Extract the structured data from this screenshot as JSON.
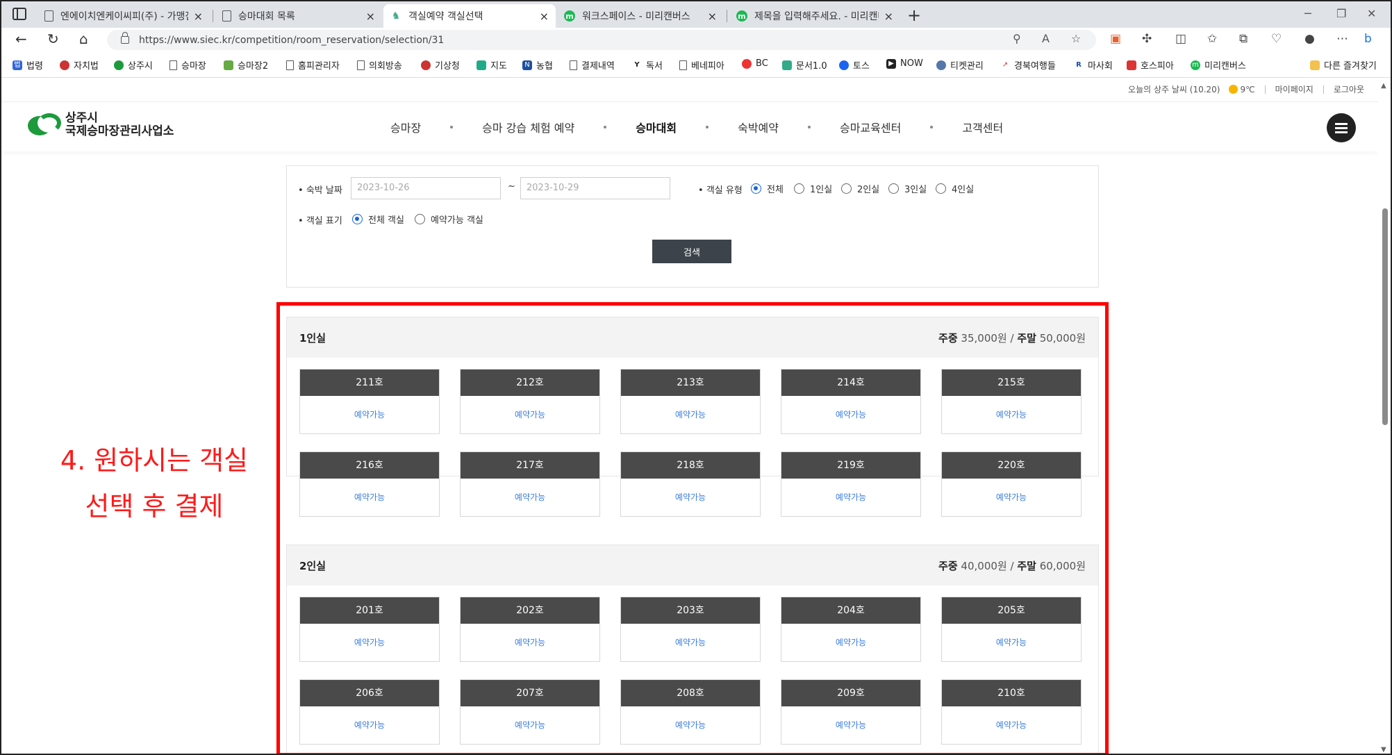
{
  "browser": {
    "tabs": [
      {
        "title": "엔에이치엔케이씨피(주) - 가맹점",
        "icon": "doc"
      },
      {
        "title": "승마대회 목록",
        "icon": "doc"
      },
      {
        "title": "객실예약 객실선택",
        "icon": "horse"
      },
      {
        "title": "워크스페이스 - 미리캔버스",
        "icon": "green"
      },
      {
        "title": "제목을 입력해주세요. - 미리캔버",
        "icon": "green"
      }
    ],
    "url": "https://www.siec.kr/competition/room_reservation/selection/31",
    "bookmarks": [
      "법령",
      "자치법",
      "상주시",
      "승마장",
      "승마장2",
      "홈피관리자",
      "의회방송",
      "기상청",
      "지도",
      "농협",
      "결제내역",
      "독서",
      "베네피아",
      "BC",
      "문서1.0",
      "토스",
      "NOW",
      "티켓관리",
      "경북여행들",
      "마사회",
      "호스피아",
      "미리캔버스"
    ],
    "other_bookmarks": "다른 즐겨찾기"
  },
  "site": {
    "top_info": {
      "weather_label": "오늘의 상주 날씨 (10.20)",
      "temp": "9℃",
      "mypage": "마이페이지",
      "logout": "로그아웃"
    },
    "logo": {
      "line1": "상주시",
      "line2": "국제승마장관리사업소"
    },
    "nav": [
      "승마장",
      "승마 강습 체험 예약",
      "승마대회",
      "숙박예약",
      "승마교육센터",
      "고객센터"
    ],
    "nav_active": "승마대회"
  },
  "search": {
    "date_label": "숙박 날짜",
    "date_from": "2023-10-26",
    "date_to": "2023-10-29",
    "tilde": "~",
    "type_label": "객실 유형",
    "type_options": [
      "전체",
      "1인실",
      "2인실",
      "3인실",
      "4인실"
    ],
    "type_selected": 0,
    "display_label": "객실 표기",
    "display_options": [
      "전체 객실",
      "예약가능 객실"
    ],
    "display_selected": 0,
    "button": "검색"
  },
  "groups": [
    {
      "title": "1인실",
      "weekday_label": "주중",
      "weekday_price": "35,000원",
      "weekend_label": "주말",
      "weekend_price": "50,000원",
      "rooms": [
        {
          "name": "211호",
          "status": "예약가능"
        },
        {
          "name": "212호",
          "status": "예약가능"
        },
        {
          "name": "213호",
          "status": "예약가능"
        },
        {
          "name": "214호",
          "status": "예약가능"
        },
        {
          "name": "215호",
          "status": "예약가능"
        },
        {
          "name": "216호",
          "status": "예약가능"
        },
        {
          "name": "217호",
          "status": "예약가능"
        },
        {
          "name": "218호",
          "status": "예약가능"
        },
        {
          "name": "219호",
          "status": "예약가능"
        },
        {
          "name": "220호",
          "status": "예약가능"
        }
      ]
    },
    {
      "title": "2인실",
      "weekday_label": "주중",
      "weekday_price": "40,000원",
      "weekend_label": "주말",
      "weekend_price": "60,000원",
      "rooms": [
        {
          "name": "201호",
          "status": "예약가능"
        },
        {
          "name": "202호",
          "status": "예약가능"
        },
        {
          "name": "203호",
          "status": "예약가능"
        },
        {
          "name": "204호",
          "status": "예약가능"
        },
        {
          "name": "205호",
          "status": "예약가능"
        },
        {
          "name": "206호",
          "status": "예약가능"
        },
        {
          "name": "207호",
          "status": "예약가능"
        },
        {
          "name": "208호",
          "status": "예약가능"
        },
        {
          "name": "209호",
          "status": "예약가능"
        },
        {
          "name": "210호",
          "status": "예약가능"
        }
      ]
    }
  ],
  "annotation": {
    "line1": "4. 원하시는 객실",
    "line2": "선택 후 결제",
    "color": "#ff0000"
  },
  "colors": {
    "room_header": "#4a4a4a",
    "available": "#3b7ddd",
    "radio_on": "#1a63d8",
    "brand_green": "#1d9a3c"
  }
}
